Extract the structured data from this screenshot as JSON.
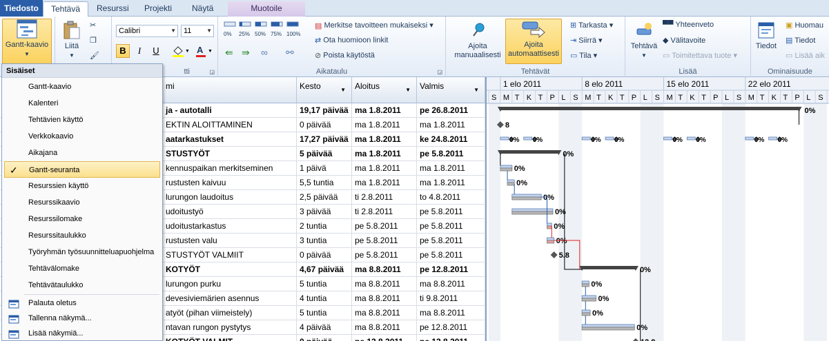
{
  "tabs": {
    "file": "Tiedosto",
    "task": "Tehtävä",
    "resource": "Resurssi",
    "project": "Projekti",
    "view": "Näytä",
    "format": "Muotoile"
  },
  "ribbon": {
    "gantt_label": "Gantt-kaavio",
    "paste_label": "Liitä",
    "font_name": "Calibri",
    "font_size": "11",
    "bold": "B",
    "italic": "I",
    "underline": "U",
    "pct": [
      "0%",
      "25%",
      "50%",
      "75%",
      "100%"
    ],
    "mark_on_track": "Merkitse tavoitteen mukaiseksi",
    "respect_links": "Ota huomioon linkit",
    "inactivate": "Poista käytöstä",
    "schedule_group": "Aikataulu",
    "font_group": "tti",
    "manual": "Ajoita manuaalisesti",
    "auto": "Ajoita automaattisesti",
    "tasks_group": "Tehtävät",
    "inspect": "Tarkasta",
    "move": "Siirrä",
    "mode": "Tila",
    "task_btn": "Tehtävä",
    "summary": "Yhteenveto",
    "milestone": "Välitavoite",
    "deliverable": "Toimitettava tuote",
    "insert_group": "Lisää",
    "info": "Tiedot",
    "notes": "Huomau",
    "details": "Tiedot",
    "add_to_tl": "Lisää aik",
    "properties_group": "Ominaisuude"
  },
  "menu": {
    "header": "Sisäiset",
    "items": [
      "Gantt-kaavio",
      "Kalenteri",
      "Tehtävien käyttö",
      "Verkkokaavio",
      "Aikajana",
      "Gantt-seuranta",
      "Resurssien käyttö",
      "Resurssikaavio",
      "Resurssilomake",
      "Resurssitaulukko",
      "Työryhmän työsuunnitteluapuohjelma",
      "Tehtävälomake",
      "Tehtävätaulukko"
    ],
    "checked": "✓",
    "actions": [
      "Palauta oletus",
      "Tallenna näkymä...",
      "Lisää näkymiä..."
    ]
  },
  "table": {
    "headers": {
      "name": "mi",
      "duration": "Kesto",
      "start": "Aloitus",
      "finish": "Valmis"
    },
    "rows": [
      {
        "name": "ja - autotalli",
        "duration": "19,17 päivää",
        "start": "ma 1.8.2011",
        "finish": "pe 26.8.2011",
        "bold": true
      },
      {
        "name": "EKTIN ALOITTAMINEN",
        "duration": "0 päivää",
        "start": "ma 1.8.2011",
        "finish": "ma 1.8.2011",
        "bold": false
      },
      {
        "name": "aatarkastukset",
        "duration": "17,27 päivää",
        "start": "ma 1.8.2011",
        "finish": "ke 24.8.2011",
        "bold": true
      },
      {
        "name": "STUSTYÖT",
        "duration": "5 päivää",
        "start": "ma 1.8.2011",
        "finish": "pe 5.8.2011",
        "bold": true
      },
      {
        "name": "kennuspaikan merkitseminen",
        "duration": "1 päivä",
        "start": "ma 1.8.2011",
        "finish": "ma 1.8.2011",
        "bold": false
      },
      {
        "name": "rustusten kaivuu",
        "duration": "5,5 tuntia",
        "start": "ma 1.8.2011",
        "finish": "ma 1.8.2011",
        "bold": false
      },
      {
        "name": "lurungon laudoitus",
        "duration": "2,5 päivää",
        "start": "ti 2.8.2011",
        "finish": "to 4.8.2011",
        "bold": false
      },
      {
        "name": "udoitustyö",
        "duration": "3 päivää",
        "start": "ti 2.8.2011",
        "finish": "pe 5.8.2011",
        "bold": false
      },
      {
        "name": "udoitustarkastus",
        "duration": "2 tuntia",
        "start": "pe 5.8.2011",
        "finish": "pe 5.8.2011",
        "bold": false
      },
      {
        "name": "rustusten valu",
        "duration": "3 tuntia",
        "start": "pe 5.8.2011",
        "finish": "pe 5.8.2011",
        "bold": false
      },
      {
        "name": "STUSTYÖT VALMIIT",
        "duration": "0 päivää",
        "start": "pe 5.8.2011",
        "finish": "pe 5.8.2011",
        "bold": false
      },
      {
        "name": "KOTYÖT",
        "duration": "4,67 päivää",
        "start": "ma 8.8.2011",
        "finish": "pe 12.8.2011",
        "bold": true
      },
      {
        "name": "lurungon purku",
        "duration": "5 tuntia",
        "start": "ma 8.8.2011",
        "finish": "ma 8.8.2011",
        "bold": false
      },
      {
        "name": "devesiviemärien asennus",
        "duration": "4 tuntia",
        "start": "ma 8.8.2011",
        "finish": "ti 9.8.2011",
        "bold": false
      },
      {
        "name": "atyöt (pihan viimeistely)",
        "duration": "5 tuntia",
        "start": "ma 8.8.2011",
        "finish": "ma 8.8.2011",
        "bold": false
      },
      {
        "name": "ntavan rungon pystytys",
        "duration": "4 päivää",
        "start": "ma 8.8.2011",
        "finish": "pe 12.8.2011",
        "bold": false
      },
      {
        "name": "KOTYÖT VALMIT",
        "duration": "0 päivää",
        "start": "pe 12.8.2011",
        "finish": "pe 12.8.2011",
        "bold": true
      }
    ]
  },
  "gantt": {
    "weeks": [
      "1 elo 2011",
      "8 elo 2011",
      "15 elo 2011",
      "22 elo 2011"
    ],
    "days": [
      "S",
      "M",
      "T",
      "K",
      "T",
      "P",
      "L"
    ],
    "labels": {
      "pct0": "0%",
      "m1": "8",
      "m2": "5.8",
      "m3": "12.8"
    }
  },
  "colors": {
    "accent": "#2a5ea8",
    "selected": "#fbd25e",
    "critical": "#e02020",
    "bar": "#6b8cc7",
    "summary": "#444444"
  }
}
